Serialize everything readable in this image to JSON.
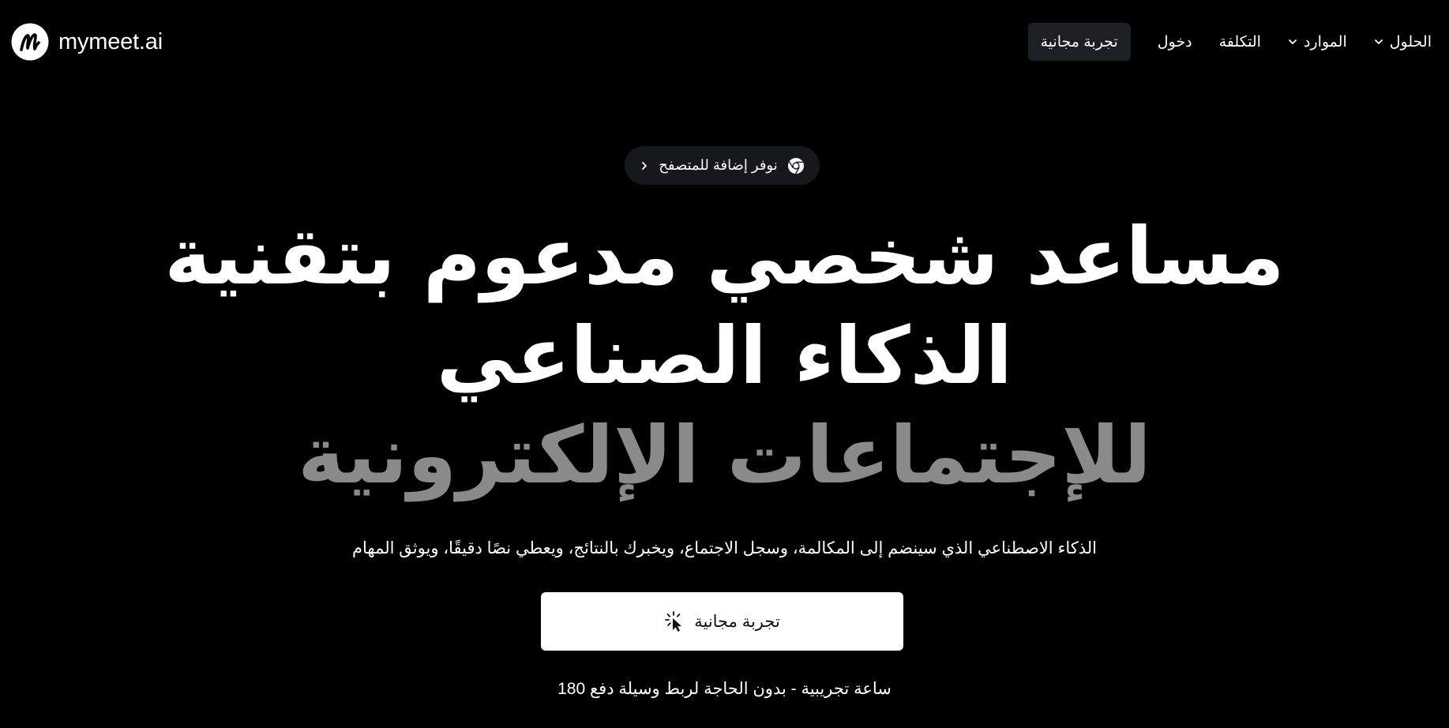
{
  "brand": {
    "name": "mymeet.ai",
    "logo_icon": "mymeet-logo-icon"
  },
  "nav": {
    "cta_label": "تجربة مجانية",
    "login_label": "دخول",
    "pricing_label": "التكلفة",
    "resources_label": "الموارد",
    "solutions_label": "الحلول"
  },
  "extension_pill": {
    "label": "نوفر إضافة للمتصفح",
    "icon": "chrome-icon"
  },
  "hero": {
    "line1": "مساعد شخصي مدعوم بتقنية",
    "line2": "الذكاء الصناعي",
    "line3": "للإجتماعات الإلكترونية",
    "subtitle": "الذكاء الاصطناعي الذي سينضم إلى المكالمة، وسجل الاجتماع، ويخبرك بالنتائج، ويعطي نصًا دقيقًا، ويوثق المهام",
    "cta_label": "تجربة مجانية",
    "cta_icon": "cursor-click-icon",
    "note": "ساعة تجريبية - بدون الحاجة لربط وسيلة دفع 180"
  },
  "colors": {
    "background": "#000000",
    "text": "#ffffff",
    "headline_muted": "#8a8a8a",
    "nav_cta_bg": "#1c1f24",
    "pill_bg": "#16181c",
    "cta_bg": "#ffffff"
  }
}
